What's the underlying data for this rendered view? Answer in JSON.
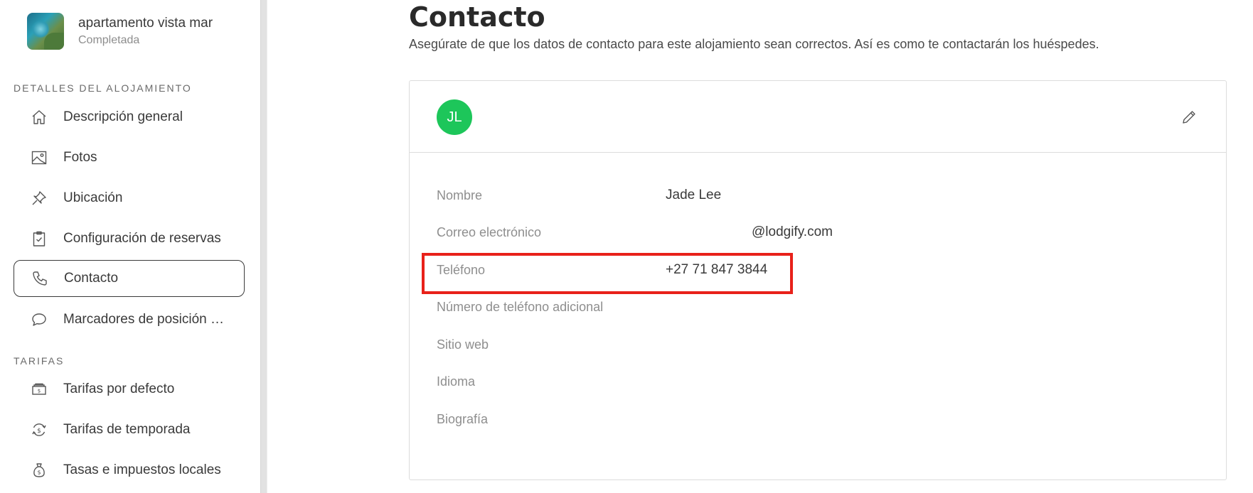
{
  "property": {
    "name": "apartamento vista mar",
    "status": "Completada"
  },
  "sidebar": {
    "section_details": "DETALLES DEL ALOJAMIENTO",
    "section_rates": "TARIFAS",
    "items": [
      {
        "label": "Descripción general",
        "icon": "home-icon"
      },
      {
        "label": "Fotos",
        "icon": "image-icon"
      },
      {
        "label": "Ubicación",
        "icon": "pin-icon"
      },
      {
        "label": "Configuración de reservas",
        "icon": "clipboard-check-icon"
      },
      {
        "label": "Contacto",
        "icon": "phone-icon",
        "active": true
      },
      {
        "label": "Marcadores de posición o…",
        "icon": "chat-bubble-icon"
      }
    ],
    "rate_items": [
      {
        "label": "Tarifas por defecto",
        "icon": "money-stack-icon"
      },
      {
        "label": "Tarifas de temporada",
        "icon": "dollar-cycle-icon"
      },
      {
        "label": "Tasas e impuestos locales",
        "icon": "money-bag-icon"
      }
    ]
  },
  "main": {
    "title": "Contacto",
    "subtitle": "Asegúrate de que los datos de contacto para este alojamiento sean correctos. Así es como te contactarán los huéspedes."
  },
  "contact": {
    "avatar_initials": "JL",
    "avatar_color": "#1dc65a",
    "fields": [
      {
        "label": "Nombre",
        "value": "Jade Lee"
      },
      {
        "label": "Correo electrónico",
        "value": "@lodgify.com"
      },
      {
        "label": "Teléfono",
        "value": "+27 71 847 3844"
      },
      {
        "label": "Número de teléfono adicional",
        "value": ""
      },
      {
        "label": "Sitio web",
        "value": ""
      },
      {
        "label": "Idioma",
        "value": ""
      },
      {
        "label": "Biografía",
        "value": ""
      }
    ]
  },
  "highlight_color": "#e8211a"
}
